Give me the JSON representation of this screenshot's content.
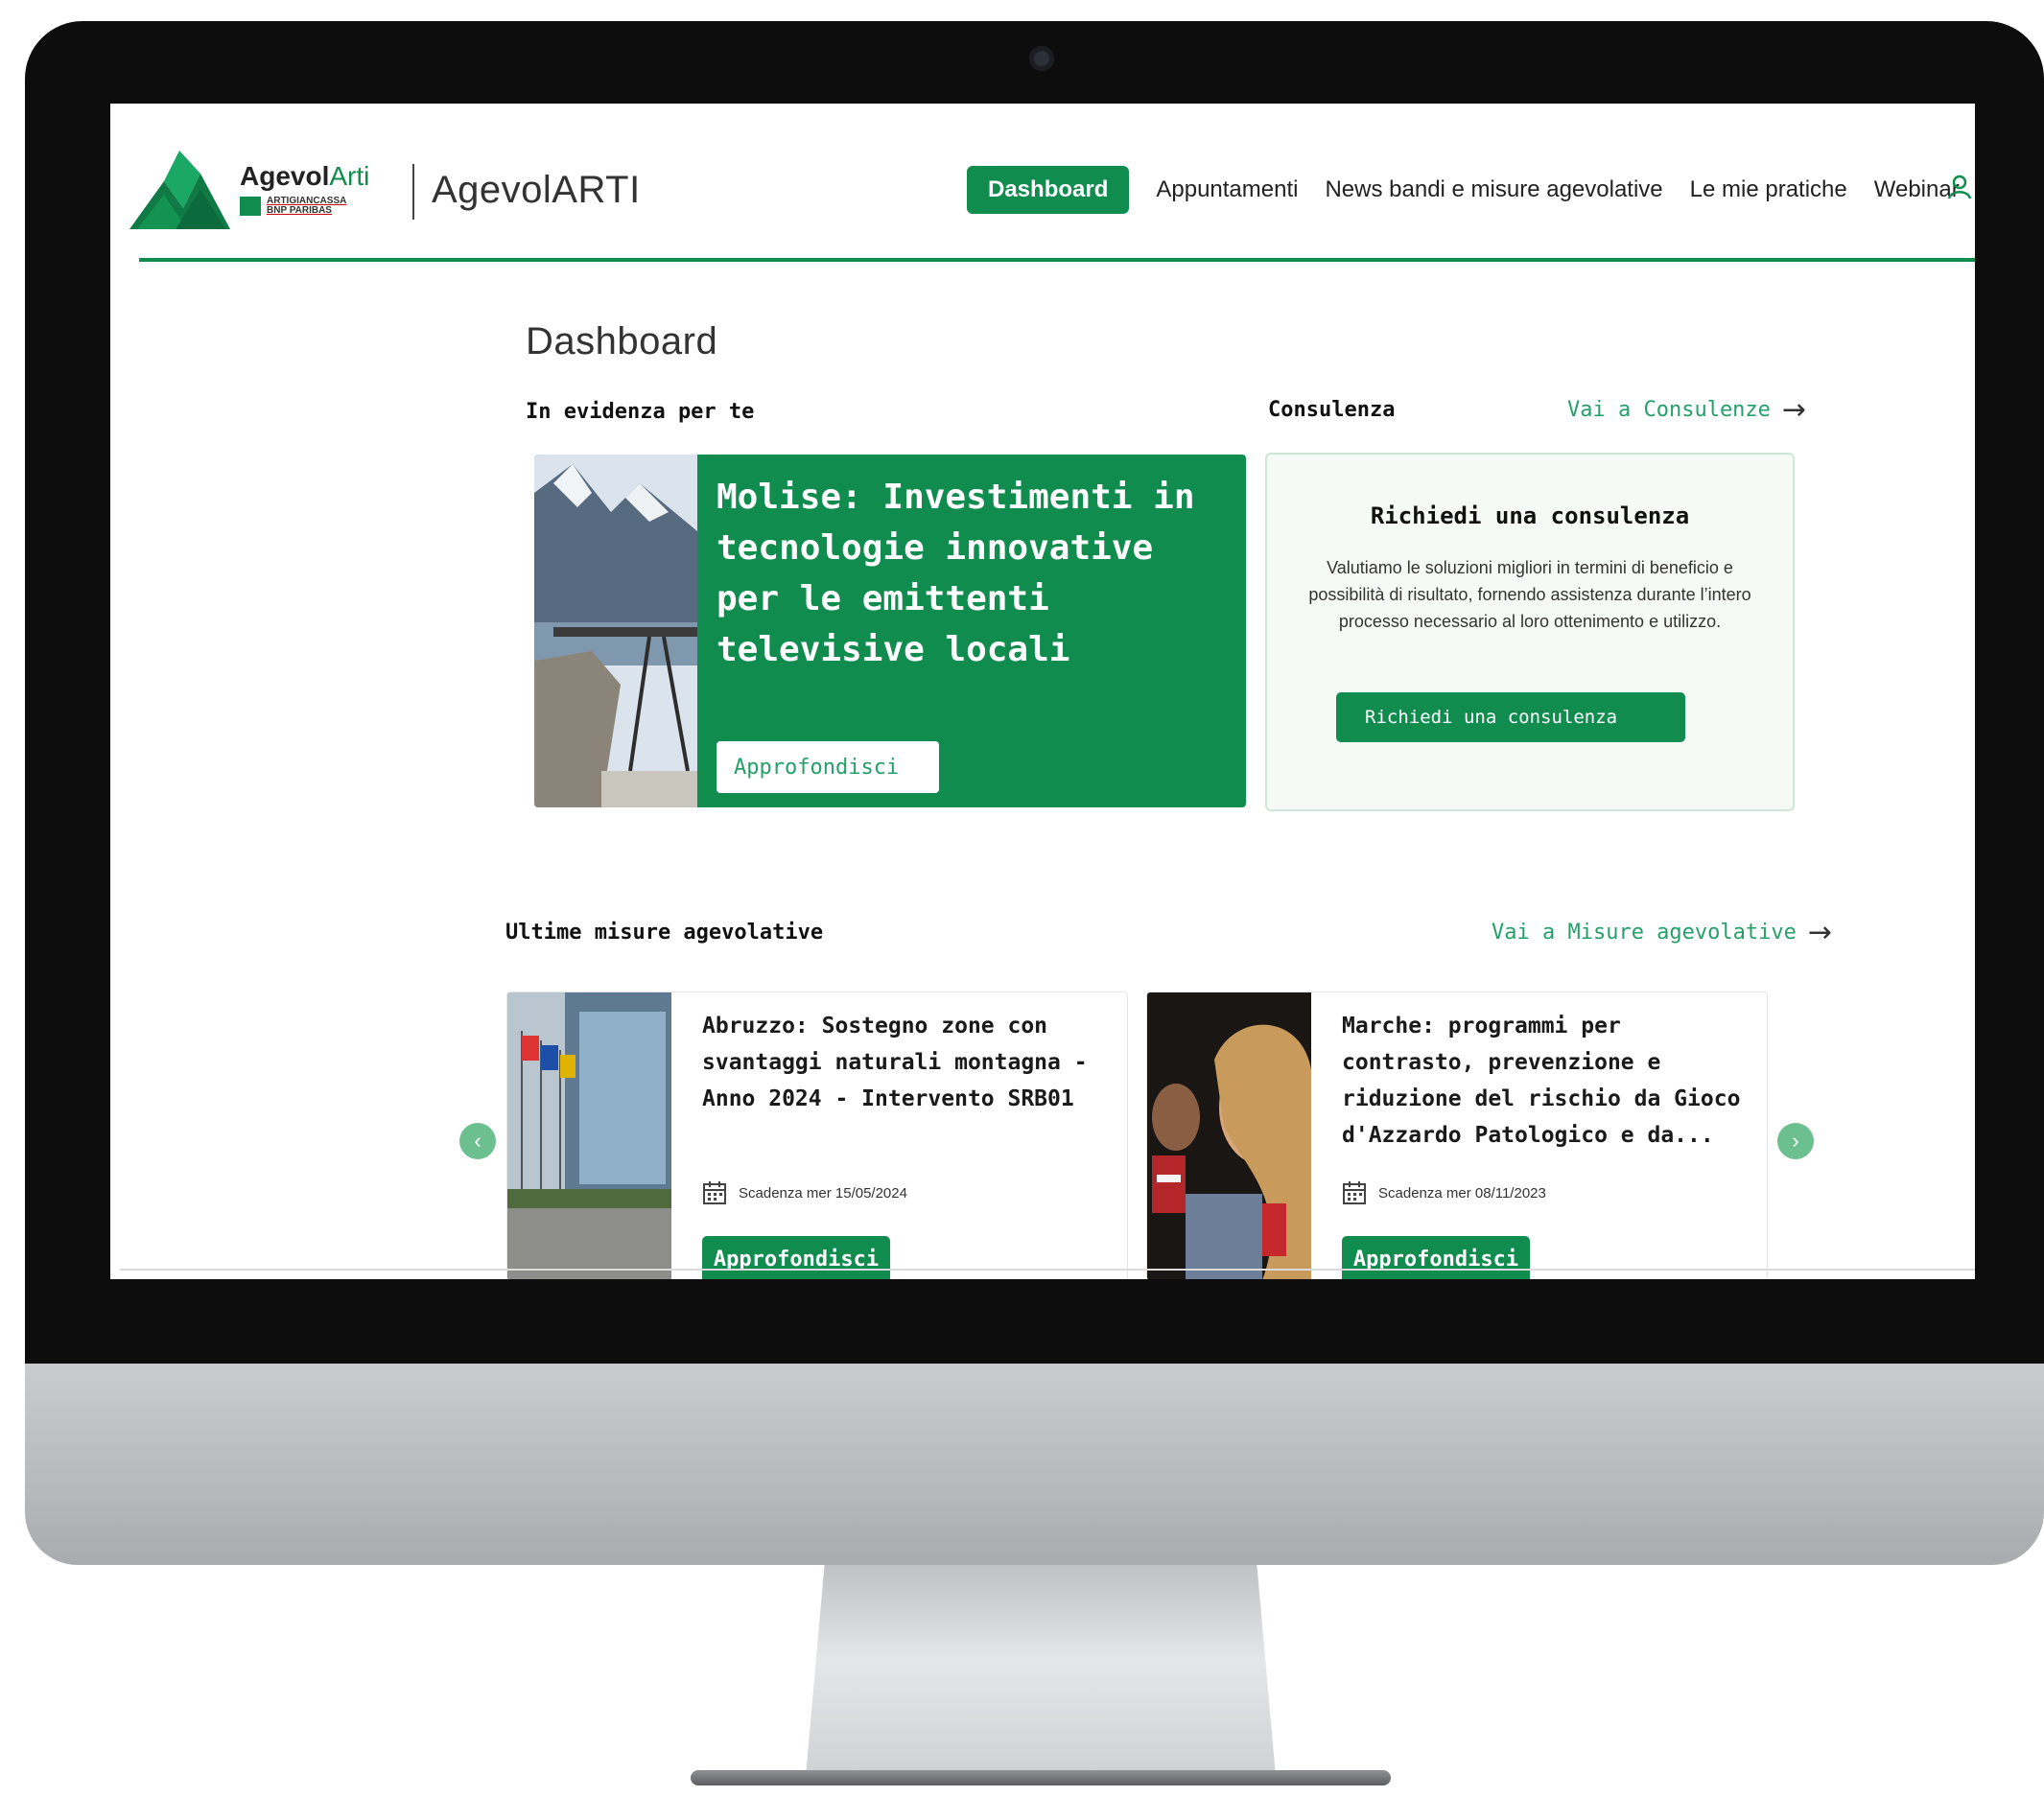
{
  "colors": {
    "brand_green": "#118c4f",
    "link_green": "#26a06a",
    "carousel_green": "#6cc08f"
  },
  "header": {
    "brand_primary": "Agevol",
    "brand_accent": "Arti",
    "brand_sub": "ARTIGIANCASSA BNP PARIBAS",
    "app_title": "AgevolARTI",
    "nav": {
      "active": "Dashboard",
      "items": [
        "Appuntamenti",
        "News bandi e misure agevolative",
        "Le mie pratiche",
        "Webinar"
      ]
    },
    "user_icon": "user-icon"
  },
  "page": {
    "title": "Dashboard"
  },
  "highlight": {
    "section_title": "In evidenza per te",
    "card": {
      "title": "Molise: Investimenti in tecnologie innovative per le emittenti televisive locali",
      "button": "Approfondisci"
    }
  },
  "consulting": {
    "section_title": "Consulenza",
    "link": "Vai a Consulenze",
    "card_title": "Richiedi una consulenza",
    "card_text": "Valutiamo le soluzioni migliori in termini di beneficio e possibilità di risultato, fornendo assistenza durante l’intero processo necessario al loro ottenimento e utilizzo.",
    "button": "Richiedi una consulenza"
  },
  "measures": {
    "section_title": "Ultime misure agevolative",
    "link": "Vai a Misure agevolative",
    "items": [
      {
        "title": "Abruzzo: Sostegno zone con svantaggi naturali montagna - Anno 2024 - Intervento SRB01",
        "deadline": "Scadenza mer 15/05/2024",
        "button": "Approfondisci"
      },
      {
        "title": "Marche: programmi per contrasto, prevenzione e riduzione del rischio da Gioco d'Azzardo Patologico e da...",
        "deadline": "Scadenza mer 08/11/2023",
        "button": "Approfondisci"
      }
    ]
  }
}
